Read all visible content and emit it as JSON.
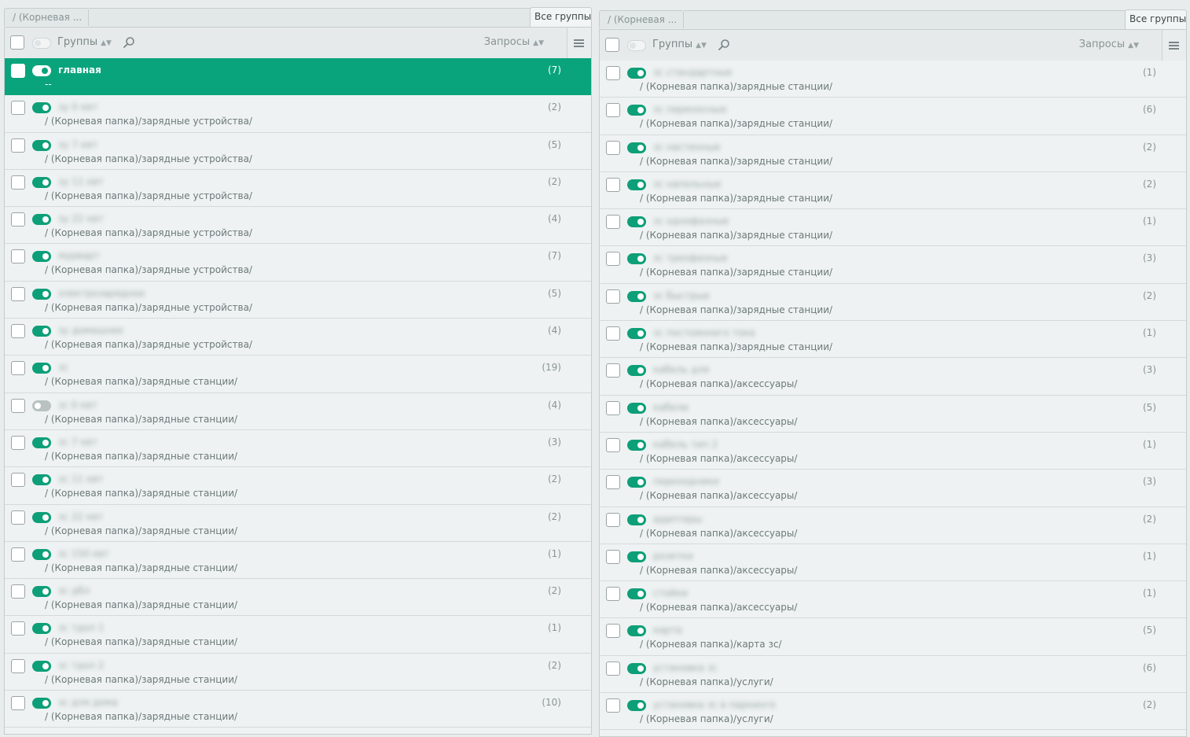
{
  "panels": [
    {
      "tab_path_label": "/ (Корневая ...",
      "tab_all_label": "Все группы",
      "header": {
        "groups_label": "Группы",
        "requests_label": "Запросы"
      },
      "rows": [
        {
          "name": "главная",
          "path": "--",
          "count": "(7)",
          "toggle": "on",
          "selected": true
        },
        {
          "name": "зу 0 квт",
          "path": "/ (Корневая папка)/зарядные устройства/",
          "count": "(2)",
          "toggle": "on"
        },
        {
          "name": "зу 7 квт",
          "path": "/ (Корневая папка)/зарядные устройства/",
          "count": "(5)",
          "toggle": "on"
        },
        {
          "name": "зу 11 квт",
          "path": "/ (Корневая папка)/зарядные устройства/",
          "count": "(2)",
          "toggle": "on"
        },
        {
          "name": "зу 22 квт",
          "path": "/ (Корневая папка)/зарядные устройства/",
          "count": "(4)",
          "toggle": "on"
        },
        {
          "name": "мурварт",
          "path": "/ (Корневая папка)/зарядные устройства/",
          "count": "(7)",
          "toggle": "on"
        },
        {
          "name": "электрозарядное",
          "path": "/ (Корневая папка)/зарядные устройства/",
          "count": "(5)",
          "toggle": "on"
        },
        {
          "name": "зу домашнее",
          "path": "/ (Корневая папка)/зарядные устройства/",
          "count": "(4)",
          "toggle": "on"
        },
        {
          "name": "зс",
          "path": "/ (Корневая папка)/зарядные станции/",
          "count": "(19)",
          "toggle": "on"
        },
        {
          "name": "зс 0 квт",
          "path": "/ (Корневая папка)/зарядные станции/",
          "count": "(4)",
          "toggle": "off"
        },
        {
          "name": "зс 7 квт",
          "path": "/ (Корневая папка)/зарядные станции/",
          "count": "(3)",
          "toggle": "on"
        },
        {
          "name": "зс 11 квт",
          "path": "/ (Корневая папка)/зарядные станции/",
          "count": "(2)",
          "toggle": "on"
        },
        {
          "name": "зс 22 квт",
          "path": "/ (Корневая папка)/зарядные станции/",
          "count": "(2)",
          "toggle": "on"
        },
        {
          "name": "зс 150 квт",
          "path": "/ (Корневая папка)/зарядные станции/",
          "count": "(1)",
          "toggle": "on"
        },
        {
          "name": "зс дбл",
          "path": "/ (Корневая папка)/зарядные станции/",
          "count": "(2)",
          "toggle": "on"
        },
        {
          "name": "зс тдол 1",
          "path": "/ (Корневая папка)/зарядные станции/",
          "count": "(1)",
          "toggle": "on"
        },
        {
          "name": "зс тдол 2",
          "path": "/ (Корневая папка)/зарядные станции/",
          "count": "(2)",
          "toggle": "on"
        },
        {
          "name": "зс для дома",
          "path": "/ (Корневая папка)/зарядные станции/",
          "count": "(10)",
          "toggle": "on"
        }
      ]
    },
    {
      "tab_path_label": "/ (Корневая ...",
      "tab_all_label": "Все группы",
      "header": {
        "groups_label": "Группы",
        "requests_label": "Запросы"
      },
      "rows": [
        {
          "name": "зс стандартные",
          "path": "/ (Корневая папка)/зарядные станции/",
          "count": "(1)",
          "toggle": "on"
        },
        {
          "name": "зс переносные",
          "path": "/ (Корневая папка)/зарядные станции/",
          "count": "(6)",
          "toggle": "on"
        },
        {
          "name": "зс настенные",
          "path": "/ (Корневая папка)/зарядные станции/",
          "count": "(2)",
          "toggle": "on"
        },
        {
          "name": "зс напольные",
          "path": "/ (Корневая папка)/зарядные станции/",
          "count": "(2)",
          "toggle": "on"
        },
        {
          "name": "зс однофазные",
          "path": "/ (Корневая папка)/зарядные станции/",
          "count": "(1)",
          "toggle": "on"
        },
        {
          "name": "зс трехфазные",
          "path": "/ (Корневая папка)/зарядные станции/",
          "count": "(3)",
          "toggle": "on"
        },
        {
          "name": "зс быстрые",
          "path": "/ (Корневая папка)/зарядные станции/",
          "count": "(2)",
          "toggle": "on"
        },
        {
          "name": "зс постоянного тока",
          "path": "/ (Корневая папка)/зарядные станции/",
          "count": "(1)",
          "toggle": "on"
        },
        {
          "name": "кабель для",
          "path": "/ (Корневая папка)/аксессуары/",
          "count": "(3)",
          "toggle": "on"
        },
        {
          "name": "кабели",
          "path": "/ (Корневая папка)/аксессуары/",
          "count": "(5)",
          "toggle": "on"
        },
        {
          "name": "кабель тип 2",
          "path": "/ (Корневая папка)/аксессуары/",
          "count": "(1)",
          "toggle": "on"
        },
        {
          "name": "переходники",
          "path": "/ (Корневая папка)/аксессуары/",
          "count": "(3)",
          "toggle": "on"
        },
        {
          "name": "адаптеры",
          "path": "/ (Корневая папка)/аксессуары/",
          "count": "(2)",
          "toggle": "on"
        },
        {
          "name": "розетки",
          "path": "/ (Корневая папка)/аксессуары/",
          "count": "(1)",
          "toggle": "on"
        },
        {
          "name": "стойки",
          "path": "/ (Корневая папка)/аксессуары/",
          "count": "(1)",
          "toggle": "on"
        },
        {
          "name": "карта",
          "path": "/ (Корневая папка)/карта зс/",
          "count": "(5)",
          "toggle": "on"
        },
        {
          "name": "установка зс",
          "path": "/ (Корневая папка)/услуги/",
          "count": "(6)",
          "toggle": "on"
        },
        {
          "name": "установка зс в паркинге",
          "path": "/ (Корневая папка)/услуги/",
          "count": "(2)",
          "toggle": "on"
        }
      ]
    }
  ]
}
